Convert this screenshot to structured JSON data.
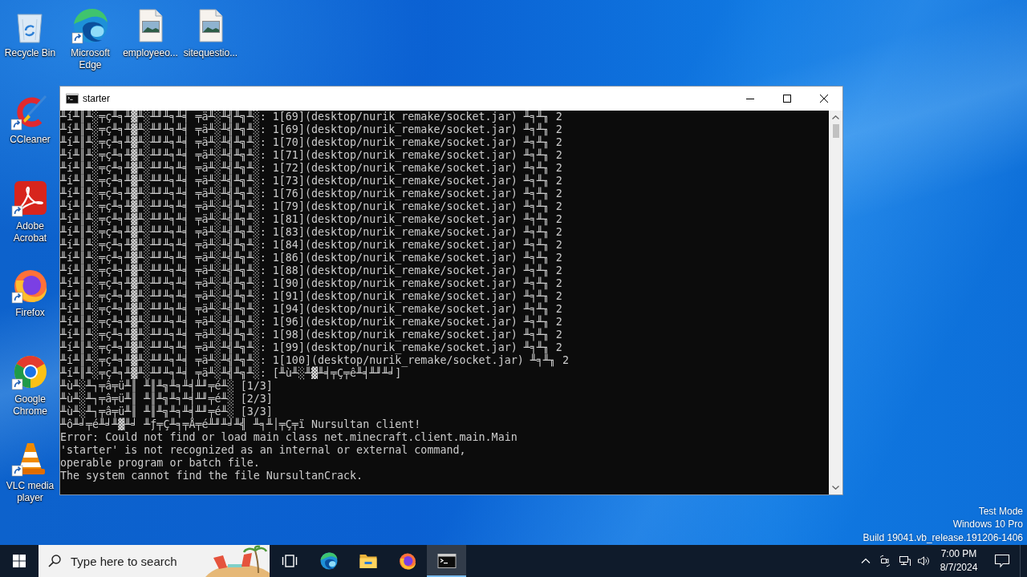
{
  "desktop": {
    "top_row": [
      {
        "kind": "recycle",
        "label": "Recycle Bin",
        "shortcut": false
      },
      {
        "kind": "edge",
        "label": "Microsoft Edge",
        "shortcut": true
      },
      {
        "kind": "image",
        "label": "employeeo...",
        "shortcut": false
      },
      {
        "kind": "image",
        "label": "sitequestio...",
        "shortcut": false
      }
    ],
    "left_column": [
      {
        "kind": "ccleaner",
        "label": "CCleaner",
        "shortcut": true
      },
      {
        "kind": "acrobat",
        "label": "Adobe Acrobat",
        "shortcut": true
      },
      {
        "kind": "firefox",
        "label": "Firefox",
        "shortcut": true
      },
      {
        "kind": "chrome",
        "label": "Google Chrome",
        "shortcut": true
      },
      {
        "kind": "vlc",
        "label": "VLC media player",
        "shortcut": true
      }
    ]
  },
  "window": {
    "title": "starter",
    "console_lines": [
      "╨í╨║╨░╤ç╨╕╨▓╨░╨╜╨╕╨╡ ╤ä╨░╨╣╨╗╨░: 1[69](desktop/nurik_remake/socket.jar) ╨╕╨╖ 2",
      "╨í╨║╨░╤ç╨╕╨▓╨░╨╜╨╕╨╡ ╤ä╨░╨╣╨╗╨░: 1[69](desktop/nurik_remake/socket.jar) ╨╕╨╖ 2",
      "╨í╨║╨░╤ç╨╕╨▓╨░╨╜╨╕╨╡ ╤ä╨░╨╣╨╗╨░: 1[70](desktop/nurik_remake/socket.jar) ╨╕╨╖ 2",
      "╨í╨║╨░╤ç╨╕╨▓╨░╨╜╨╕╨╡ ╤ä╨░╨╣╨╗╨░: 1[71](desktop/nurik_remake/socket.jar) ╨╕╨╖ 2",
      "╨í╨║╨░╤ç╨╕╨▓╨░╨╜╨╕╨╡ ╤ä╨░╨╣╨╗╨░: 1[72](desktop/nurik_remake/socket.jar) ╨╕╨╖ 2",
      "╨í╨║╨░╤ç╨╕╨▓╨░╨╜╨╕╨╡ ╤ä╨░╨╣╨╗╨░: 1[73](desktop/nurik_remake/socket.jar) ╨╕╨╖ 2",
      "╨í╨║╨░╤ç╨╕╨▓╨░╨╜╨╕╨╡ ╤ä╨░╨╣╨╗╨░: 1[76](desktop/nurik_remake/socket.jar) ╨╕╨╖ 2",
      "╨í╨║╨░╤ç╨╕╨▓╨░╨╜╨╕╨╡ ╤ä╨░╨╣╨╗╨░: 1[79](desktop/nurik_remake/socket.jar) ╨╕╨╖ 2",
      "╨í╨║╨░╤ç╨╕╨▓╨░╨╜╨╕╨╡ ╤ä╨░╨╣╨╗╨░: 1[81](desktop/nurik_remake/socket.jar) ╨╕╨╖ 2",
      "╨í╨║╨░╤ç╨╕╨▓╨░╨╜╨╕╨╡ ╤ä╨░╨╣╨╗╨░: 1[83](desktop/nurik_remake/socket.jar) ╨╕╨╖ 2",
      "╨í╨║╨░╤ç╨╕╨▓╨░╨╜╨╕╨╡ ╤ä╨░╨╣╨╗╨░: 1[84](desktop/nurik_remake/socket.jar) ╨╕╨╖ 2",
      "╨í╨║╨░╤ç╨╕╨▓╨░╨╜╨╕╨╡ ╤ä╨░╨╣╨╗╨░: 1[86](desktop/nurik_remake/socket.jar) ╨╕╨╖ 2",
      "╨í╨║╨░╤ç╨╕╨▓╨░╨╜╨╕╨╡ ╤ä╨░╨╣╨╗╨░: 1[88](desktop/nurik_remake/socket.jar) ╨╕╨╖ 2",
      "╨í╨║╨░╤ç╨╕╨▓╨░╨╜╨╕╨╡ ╤ä╨░╨╣╨╗╨░: 1[90](desktop/nurik_remake/socket.jar) ╨╕╨╖ 2",
      "╨í╨║╨░╤ç╨╕╨▓╨░╨╜╨╕╨╡ ╤ä╨░╨╣╨╗╨░: 1[91](desktop/nurik_remake/socket.jar) ╨╕╨╖ 2",
      "╨í╨║╨░╤ç╨╕╨▓╨░╨╜╨╕╨╡ ╤ä╨░╨╣╨╗╨░: 1[94](desktop/nurik_remake/socket.jar) ╨╕╨╖ 2",
      "╨í╨║╨░╤ç╨╕╨▓╨░╨╜╨╕╨╡ ╤ä╨░╨╣╨╗╨░: 1[96](desktop/nurik_remake/socket.jar) ╨╕╨╖ 2",
      "╨í╨║╨░╤ç╨╕╨▓╨░╨╜╨╕╨╡ ╤ä╨░╨╣╨╗╨░: 1[98](desktop/nurik_remake/socket.jar) ╨╕╨╖ 2",
      "╨í╨║╨░╤ç╨╕╨▓╨░╨╜╨╕╨╡ ╤ä╨░╨╣╨╗╨░: 1[99](desktop/nurik_remake/socket.jar) ╨╕╨╖ 2",
      "╨í╨║╨░╤ç╨╕╨▓╨░╨╜╨╕╨╡ ╤ä╨░╨╣╨╗╨░: 1[100](desktop/nurik_remake/socket.jar) ╨╕╨╖ 2",
      "╨í╨║╨░╤ç╨╕╨▓╨░╨╜╨╕╨╡ ╤ä╨░╨╣╨╗╨░: [╨ù╨░╨▓╨╡╤Ç╤ê╨╡╨╜╨╛]",
      "╨ù╨░╨┐╤â╤ü╨║ ╨║╨╗╨╕╨╡╨╜╤é╨░ [1/3]",
      "╨ù╨░╨┐╤â╤ü╨║ ╨║╨╗╨╕╨╡╨╜╤é╨░ [2/3]",
      "╨ù╨░╨┐╤â╤ü╨║ ╨║╨╗╨╕╨╡╨╜╤é╨░ [3/3]",
      "╨ô╨╛╤é╨╛╨▓╨╛ ╨ƒ╤Ç╨╕╤Å╤é╨╜╨╛╨╣ ╨╕╨│╤Ç╤ï Nursultan client!",
      "Error: Could not find or load main class net.minecraft.client.main.Main",
      "'starter' is not recognized as an internal or external command,",
      "operable program or batch file.",
      "The system cannot find the file NursultanCrack."
    ]
  },
  "test_mode_notice": [
    "Test Mode",
    "Windows 10 Pro",
    "Build 19041.vb_release.191206-1406"
  ],
  "taskbar": {
    "search": {
      "placeholder": "Type here to search"
    },
    "apps": [
      {
        "kind": "edge",
        "selected": false
      },
      {
        "kind": "folder",
        "selected": false
      },
      {
        "kind": "firefox",
        "selected": false
      },
      {
        "kind": "console",
        "selected": true
      }
    ],
    "clock": {
      "time": "7:00 PM",
      "date": "8/7/2024"
    }
  }
}
